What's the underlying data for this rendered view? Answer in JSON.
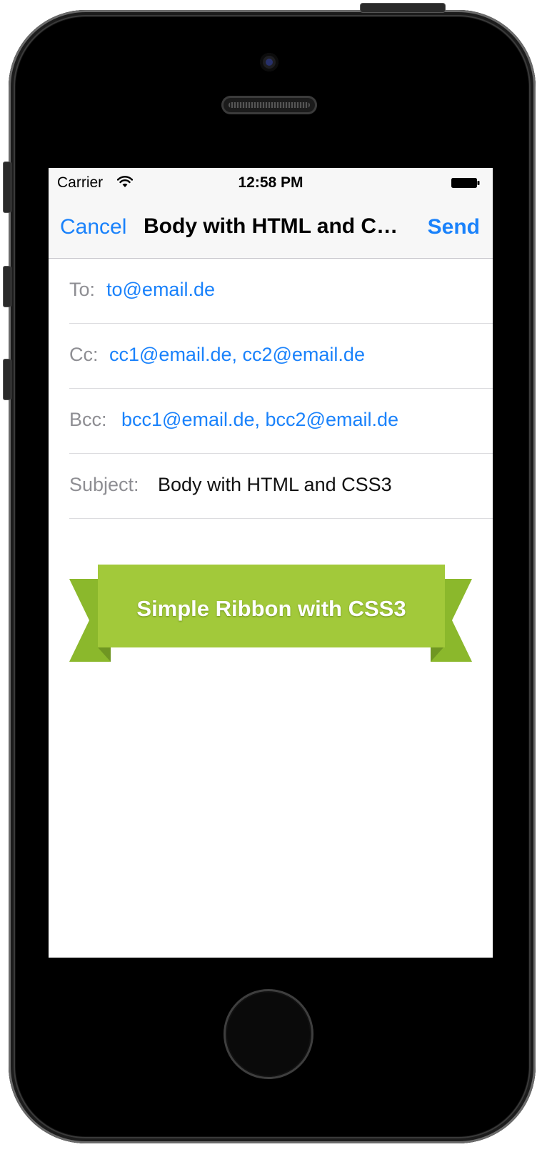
{
  "status_bar": {
    "carrier": "Carrier",
    "time": "12:58 PM"
  },
  "nav": {
    "cancel_label": "Cancel",
    "title": "Body with HTML and CSS3",
    "send_label": "Send"
  },
  "fields": {
    "to": {
      "label": "To:",
      "value": "to@email.de"
    },
    "cc": {
      "label": "Cc:",
      "value": "cc1@email.de, cc2@email.de"
    },
    "bcc": {
      "label": "Bcc:",
      "value": "bcc1@email.de, bcc2@email.de"
    },
    "subject": {
      "label": "Subject:",
      "value": "Body with HTML and CSS3"
    }
  },
  "body": {
    "ribbon_text": "Simple Ribbon with CSS3"
  },
  "colors": {
    "link_blue": "#1a82fb",
    "ribbon_green": "#a2c93a",
    "ribbon_tail": "#8bb82c",
    "ribbon_fold": "#6f9622"
  },
  "icons": {
    "wifi": "wifi-icon",
    "battery": "battery-icon"
  }
}
